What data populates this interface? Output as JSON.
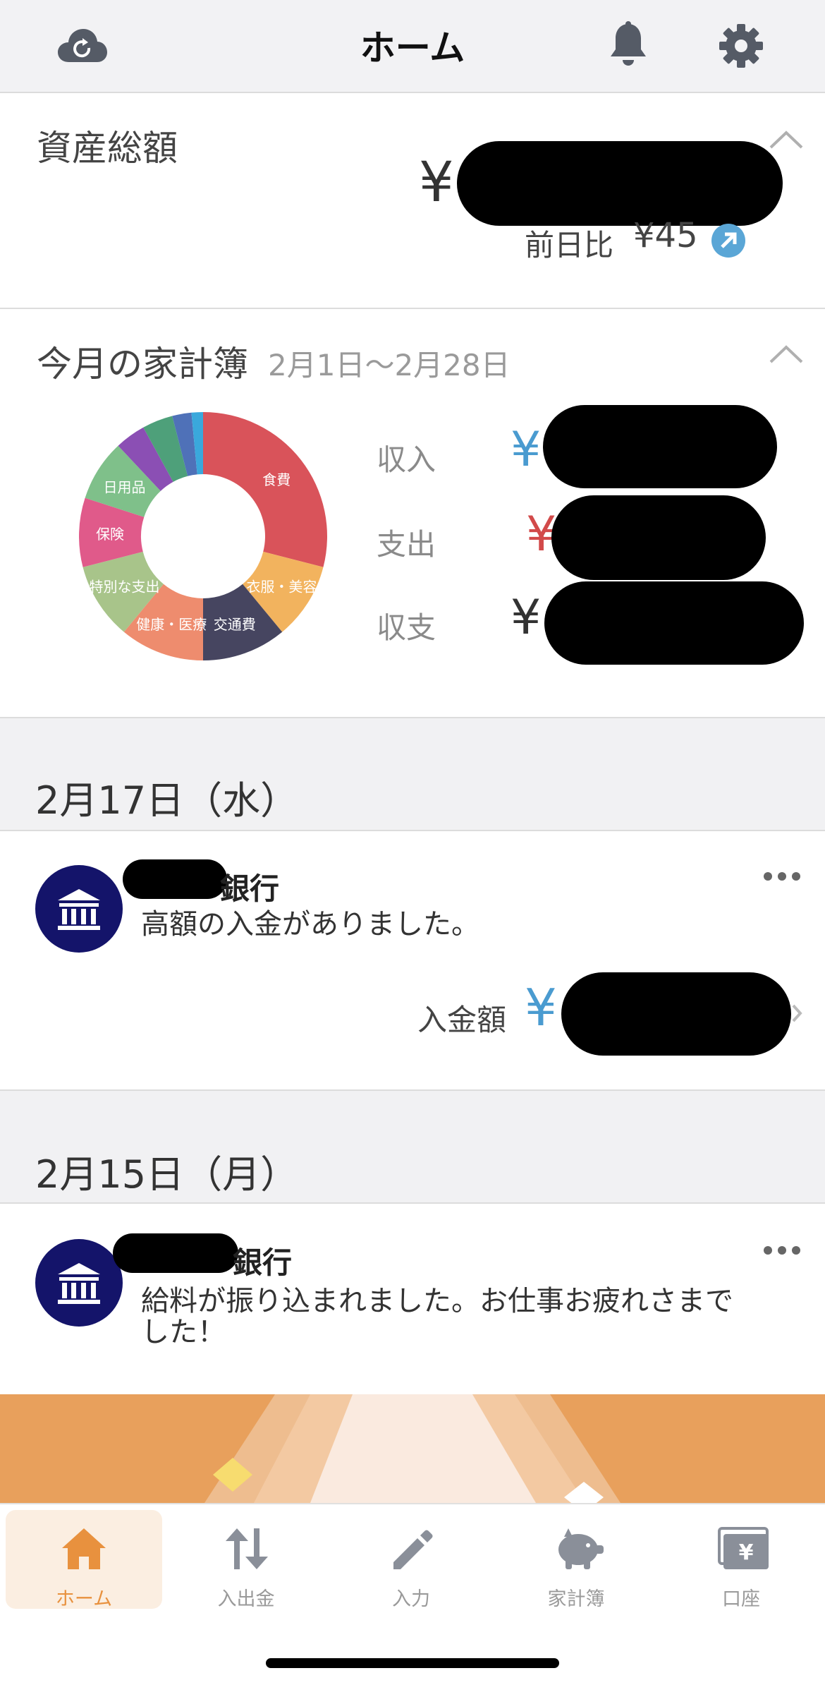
{
  "header": {
    "title": "ホーム",
    "left_icon": "cloud-sync-icon",
    "bell_icon": "bell-icon",
    "settings_icon": "gear-icon"
  },
  "assets": {
    "title": "資産総額",
    "yen": "¥",
    "daily_change_label": "前日比",
    "daily_change_value": "¥45"
  },
  "budget": {
    "title": "今月の家計簿",
    "period": "2月1日〜2月28日",
    "rows": [
      {
        "label": "収入",
        "yen": "¥",
        "color": "#4a9bd0"
      },
      {
        "label": "支出",
        "yen": "¥",
        "color": "#d24a4a"
      },
      {
        "label": "収支",
        "yen": "¥",
        "color": "#333333"
      }
    ]
  },
  "chart_data": {
    "type": "pie",
    "donut": true,
    "slices": [
      {
        "label": "食費",
        "value": 29,
        "color": "#d9535a"
      },
      {
        "label": "衣服・美容",
        "value": 10,
        "color": "#f2b35e"
      },
      {
        "label": "交通費",
        "value": 11,
        "color": "#464560"
      },
      {
        "label": "健康・医療",
        "value": 11,
        "color": "#ee8c6e"
      },
      {
        "label": "特別な支出",
        "value": 10,
        "color": "#a8c48a"
      },
      {
        "label": "保険",
        "value": 9,
        "color": "#e05a8a"
      },
      {
        "label": "日用品",
        "value": 8,
        "color": "#7fc08a"
      },
      {
        "label": "",
        "value": 4,
        "color": "#8b4fb4"
      },
      {
        "label": "",
        "value": 4,
        "color": "#4ea07a"
      },
      {
        "label": "",
        "value": 2.5,
        "color": "#4f71b8"
      },
      {
        "label": "",
        "value": 1.5,
        "color": "#3aa8dc"
      }
    ]
  },
  "feed": [
    {
      "date": "2月17日（水）",
      "bank_suffix": "銀行",
      "message": "高額の入金がありました。",
      "amount_label": "入金額",
      "amount_yen": "¥"
    },
    {
      "date": "2月15日（月）",
      "bank_suffix": "銀行",
      "message_line1": "給料が振り込まれました。お仕事お疲れさまで",
      "message_line2": "した！"
    }
  ],
  "tabs": [
    {
      "label": "ホーム",
      "icon": "home-icon",
      "active": true
    },
    {
      "label": "入出金",
      "icon": "transfer-arrows-icon",
      "active": false
    },
    {
      "label": "入力",
      "icon": "pencil-icon",
      "active": false
    },
    {
      "label": "家計簿",
      "icon": "piggy-bank-icon",
      "active": false
    },
    {
      "label": "口座",
      "icon": "wallet-yen-icon",
      "active": false
    }
  ],
  "colors": {
    "accent": "#e8913e",
    "bank_avatar": "#14146a",
    "banner": "#e8a05c"
  }
}
